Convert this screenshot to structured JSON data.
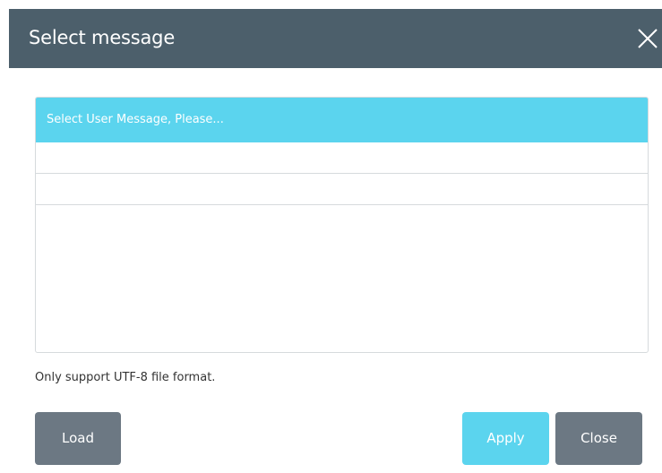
{
  "dialog": {
    "title": "Select message",
    "close_icon": "close-icon"
  },
  "list": {
    "header": "Select User Message, Please...",
    "rows": [
      "",
      ""
    ]
  },
  "note": "Only support UTF-8 file format.",
  "buttons": {
    "load": "Load",
    "apply": "Apply",
    "close": "Close"
  },
  "colors": {
    "titlebar": "#4c5f6b",
    "accent": "#5bd4ee",
    "button_gray": "#6c7883"
  }
}
